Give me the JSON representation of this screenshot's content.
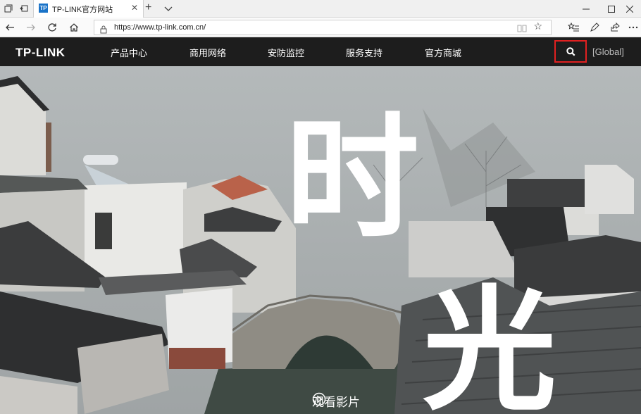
{
  "browser": {
    "tab": {
      "title": "TP-LINK官方网站",
      "favicon_text": "TP"
    },
    "address": {
      "url": "https://www.tp-link.com.cn/"
    }
  },
  "site": {
    "logo": "TP-LINK",
    "nav": [
      {
        "label": "产品中心"
      },
      {
        "label": "商用网络"
      },
      {
        "label": "安防监控"
      },
      {
        "label": "服务支持"
      },
      {
        "label": "官方商城"
      }
    ],
    "global_label": "[Global]",
    "highlight_color": "#e02020"
  },
  "hero": {
    "headline_chars": [
      "时",
      "光"
    ],
    "watch_label": "观看影片"
  }
}
